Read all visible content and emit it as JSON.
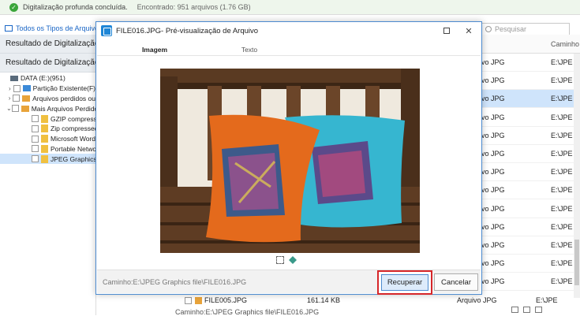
{
  "status": {
    "text": "Digitalização profunda concluída.",
    "found": "Encontrado: 951 arquivos (1.76 GB)"
  },
  "toolbar": {
    "file_types_tab": "Todos os Tipos de Arquivo",
    "search_placeholder": "Pesquisar"
  },
  "sidebar": {
    "result_tabs": [
      "Resultado de Digitalização",
      "Resultado de Digitalização"
    ],
    "tree": [
      {
        "label": "DATA (E:)(951)",
        "icon": "drive-icon",
        "arrow": "",
        "depth": 0
      },
      {
        "label": "Partição Existente(F)",
        "icon": "partition-icon",
        "arrow": "›",
        "depth": 1
      },
      {
        "label": "Arquivos perdidos ou",
        "icon": "folder-icon",
        "arrow": "›",
        "depth": 1
      },
      {
        "label": "Mais Arquivos Perdidos",
        "icon": "folder-icon",
        "arrow": "⌄",
        "depth": 1
      },
      {
        "label": "GZIP compressed",
        "icon": "file-icon",
        "arrow": "",
        "depth": 2
      },
      {
        "label": "Zip compressed",
        "icon": "file-icon",
        "arrow": "",
        "depth": 2
      },
      {
        "label": "Microsoft Word",
        "icon": "file-icon",
        "arrow": "",
        "depth": 2
      },
      {
        "label": "Portable Network",
        "icon": "file-icon",
        "arrow": "",
        "depth": 2
      },
      {
        "label": "JPEG Graphics",
        "icon": "file-icon",
        "arrow": "",
        "depth": 2,
        "selected": true
      }
    ]
  },
  "grid": {
    "path_header": "Caminho",
    "rows": [
      {
        "type": "vo JPG",
        "path": "E:\\JPE"
      },
      {
        "type": "vo JPG",
        "path": "E:\\JPE"
      },
      {
        "type": "vo JPG",
        "path": "E:\\JPE",
        "selected": true
      },
      {
        "type": "vo JPG",
        "path": "E:\\JPE"
      },
      {
        "type": "vo JPG",
        "path": "E:\\JPE"
      },
      {
        "type": "vo JPG",
        "path": "E:\\JPE"
      },
      {
        "type": "vo JPG",
        "path": "E:\\JPE"
      },
      {
        "type": "vo JPG",
        "path": "E:\\JPE"
      },
      {
        "type": "vo JPG",
        "path": "E:\\JPE"
      },
      {
        "type": "vo JPG",
        "path": "E:\\JPE"
      },
      {
        "type": "vo JPG",
        "path": "E:\\JPE"
      },
      {
        "type": "vo JPG",
        "path": "E:\\JPE"
      },
      {
        "type": "vo JPG",
        "path": "E:\\JPE"
      }
    ],
    "last_row": {
      "name": "FILE005.JPG",
      "size": "161.14 KB",
      "type": "Arquivo JPG",
      "path": "E:\\JPE"
    },
    "bottom_path": "Caminho:E:\\JPEG Graphics file\\FILE016.JPG"
  },
  "dialog": {
    "title": "FILE016.JPG- Pré-visualização de Arquivo",
    "tabs": [
      "Imagem",
      "Texto"
    ],
    "path": "Caminho:E:\\JPEG Graphics file\\FILE016.JPG",
    "recover_label": "Recuperar",
    "cancel_label": "Cancelar",
    "highlight_color": "#d6262a"
  }
}
